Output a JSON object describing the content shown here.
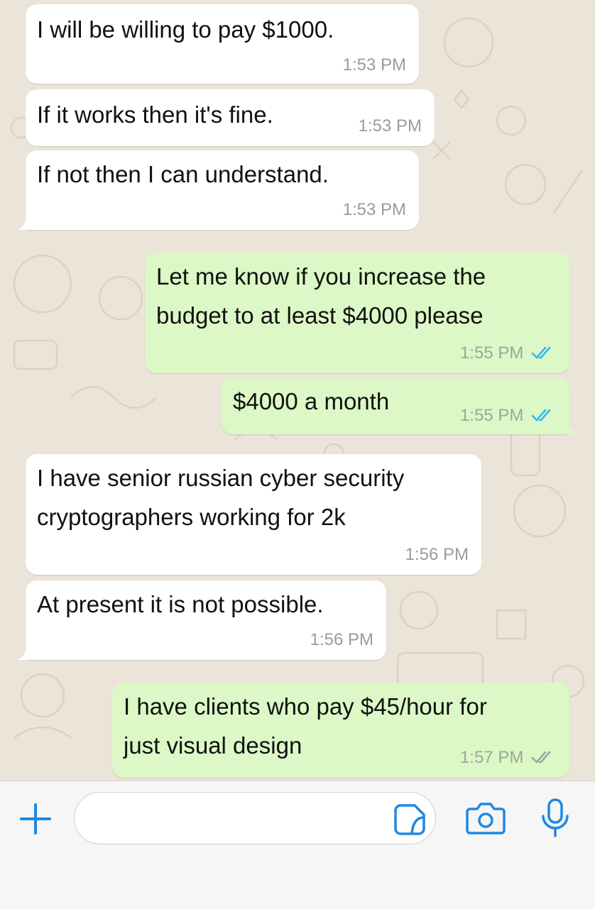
{
  "messages": [
    {
      "direction": "incoming",
      "text": "I will be willing to pay $1000.",
      "time": "1:53 PM"
    },
    {
      "direction": "incoming",
      "text": "If it works then it's fine.",
      "time": "1:53 PM"
    },
    {
      "direction": "incoming",
      "text": "If not then I can understand.",
      "time": "1:53 PM"
    },
    {
      "direction": "outgoing",
      "text_lines": [
        "Let me know if you increase the",
        "budget to at least $4000 please"
      ],
      "time": "1:55 PM",
      "read": true
    },
    {
      "direction": "outgoing",
      "text": "$4000 a month",
      "time": "1:55 PM",
      "read": true
    },
    {
      "direction": "incoming",
      "text_lines": [
        "I have senior russian cyber security",
        "cryptographers working for 2k"
      ],
      "time": "1:56 PM"
    },
    {
      "direction": "incoming",
      "text": "At present it is not possible.",
      "time": "1:56 PM"
    },
    {
      "direction": "outgoing",
      "text_lines": [
        "I have clients who pay $45/hour for",
        "just visual design"
      ],
      "time": "1:57 PM",
      "read": false
    }
  ],
  "composer": {
    "input_value": "",
    "icons": [
      "plus-icon",
      "sticker-icon",
      "camera-icon",
      "microphone-icon"
    ]
  },
  "colors": {
    "incoming_bubble": "#ffffff",
    "outgoing_bubble": "#dcf8c6",
    "chat_background": "#ebe4d8",
    "read_ticks": "#34b7f1",
    "delivered_ticks": "#9aa89a",
    "accent": "#1e88e5"
  }
}
